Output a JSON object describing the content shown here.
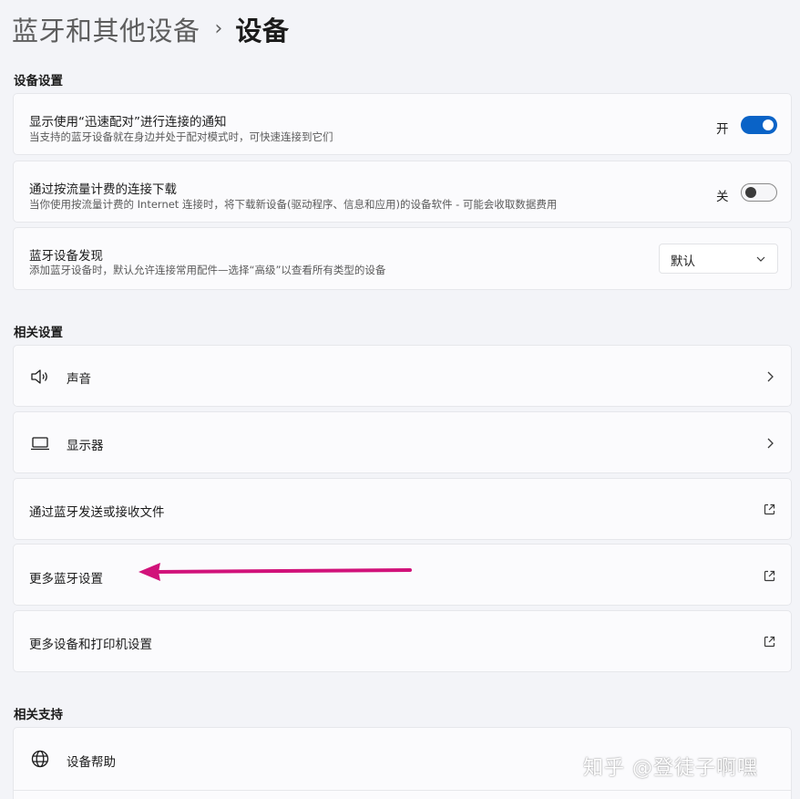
{
  "breadcrumb": {
    "parent": "蓝牙和其他设备",
    "separator": "›",
    "current": "设备"
  },
  "device_settings": {
    "section_title": "设备设置",
    "swift_pair": {
      "title": "显示使用“迅速配对”进行连接的通知",
      "desc": "当支持的蓝牙设备就在身边并处于配对模式时，可快速连接到它们",
      "toggle_label": "开",
      "state": "on"
    },
    "metered_download": {
      "title": "通过按流量计费的连接下载",
      "desc": "当你使用按流量计费的 Internet 连接时，将下载新设备(驱动程序、信息和应用)的设备软件 - 可能会收取数据费用",
      "toggle_label": "关",
      "state": "off"
    },
    "discovery": {
      "title": "蓝牙设备发现",
      "desc": "添加蓝牙设备时，默认允许连接常用配件—选择“高级”以查看所有类型的设备",
      "selected": "默认"
    }
  },
  "related_settings": {
    "section_title": "相关设置",
    "items": [
      {
        "label": "声音",
        "icon": "speaker-icon",
        "action": "chevron-right-icon"
      },
      {
        "label": "显示器",
        "icon": "laptop-icon",
        "action": "chevron-right-icon"
      },
      {
        "label": "通过蓝牙发送或接收文件",
        "action": "external-link-icon"
      },
      {
        "label": "更多蓝牙设置",
        "action": "external-link-icon"
      },
      {
        "label": "更多设备和打印机设置",
        "action": "external-link-icon"
      }
    ]
  },
  "related_support": {
    "section_title": "相关支持",
    "items": [
      {
        "label": "设备帮助",
        "icon": "globe-icon"
      }
    ]
  },
  "annotation": {
    "arrow_color": "#d1127a"
  },
  "watermark": "知乎 @登徒子啊嘿",
  "colors": {
    "accent": "#0a63c7",
    "background": "#f3f4f8",
    "card": "#fbfbfd"
  }
}
